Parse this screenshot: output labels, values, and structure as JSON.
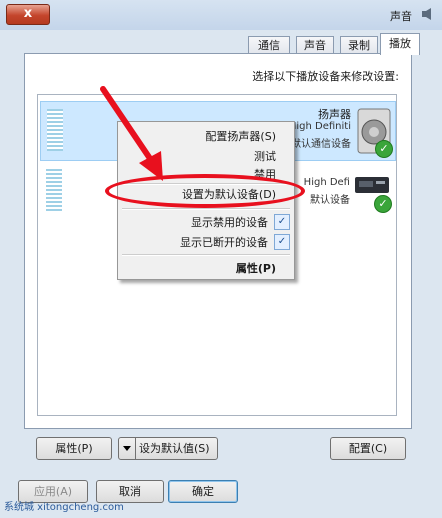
{
  "window": {
    "title": "声音",
    "close_label": "x"
  },
  "tabs": [
    {
      "label": "播放"
    },
    {
      "label": "录制"
    },
    {
      "label": "声音"
    },
    {
      "label": "通信"
    }
  ],
  "panel": {
    "instruction": "选择以下播放设备来修改设置:"
  },
  "devices": [
    {
      "name": "扬声器",
      "line1": "High Definiti",
      "line2": "默认通信设备"
    },
    {
      "name": "",
      "line1": "High Defi",
      "line2": "默认设备"
    }
  ],
  "context_menu": {
    "items": [
      {
        "label": "配置扬声器(S)"
      },
      {
        "label": "测试"
      },
      {
        "label": "禁用"
      },
      {
        "label": "设置为默认设备(D)"
      },
      {
        "label": "显示禁用的设备",
        "checked": true
      },
      {
        "label": "显示已断开的设备",
        "checked": true
      },
      {
        "label": "属性(P)"
      }
    ],
    "check_glyph": "✓"
  },
  "buttons": {
    "configure": "配置(C)",
    "set_default": "设为默认值(S)",
    "properties": "属性(P)",
    "ok": "确定",
    "cancel": "取消",
    "apply": "应用(A)"
  },
  "watermark": "系统城 xitongcheng.com",
  "colors": {
    "highlight_ring": "#e8101e",
    "arrow": "#e8101e",
    "selection": "#cde8ff"
  },
  "icons": [
    "speaker-icon",
    "hdmi-device-icon",
    "default-check-icon",
    "arrow-annotation",
    "dropdown-arrow-icon"
  ]
}
